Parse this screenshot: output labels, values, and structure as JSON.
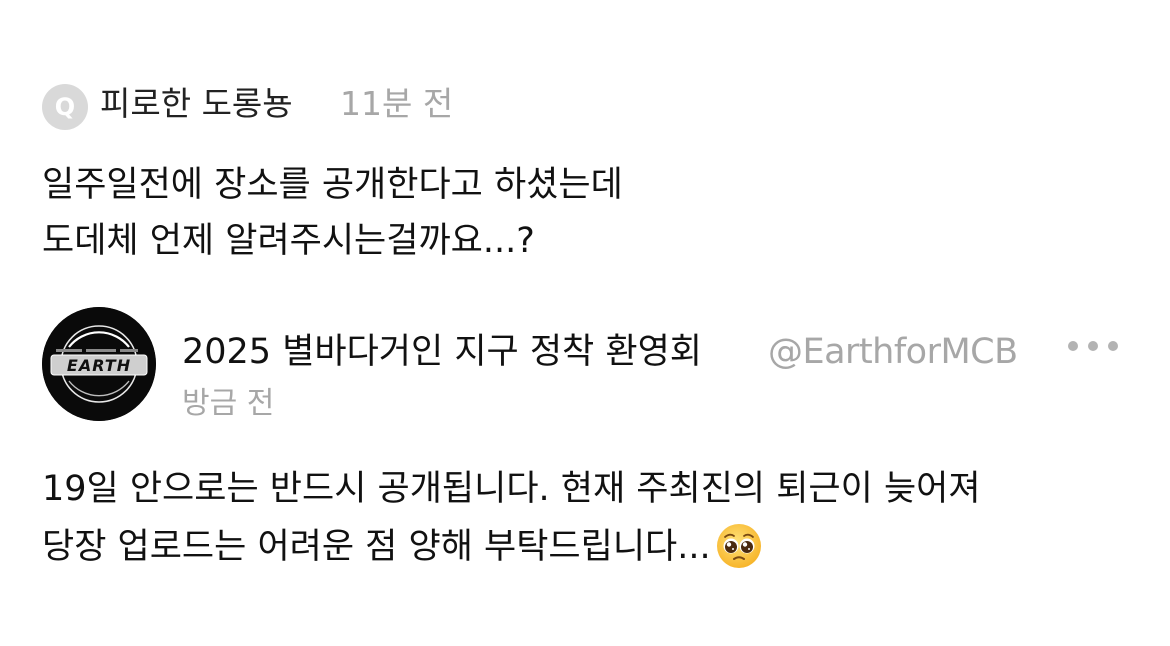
{
  "question": {
    "icon_letter": "Q",
    "author": "피로한 도롱뇽",
    "time": "11분 전",
    "body_lines": [
      "일주일전에 장소를 공개한다고 하셨는데",
      "도데체 언제 알려주시는걸까요...?"
    ]
  },
  "reply": {
    "avatar_logo_text": "EARTH",
    "display_name": "2025 별바다거인 지구 정착 환영회",
    "handle": "@EarthforMCB",
    "time": "방금 전",
    "more_icon": "more-horizontal-icon",
    "body_lines": [
      "19일 안으로는 반드시 공개됩니다. 현재 주최진의 퇴근이 늦어져",
      "당장 업로드는 어려운 점 양해 부탁드립니다..."
    ],
    "trailing_emoji": "pleading-face-emoji"
  },
  "colors": {
    "text": "#111111",
    "muted": "#a7a7a7",
    "q_icon_bg": "#d9d9d9",
    "avatar_bg": "#0a0a0a"
  }
}
